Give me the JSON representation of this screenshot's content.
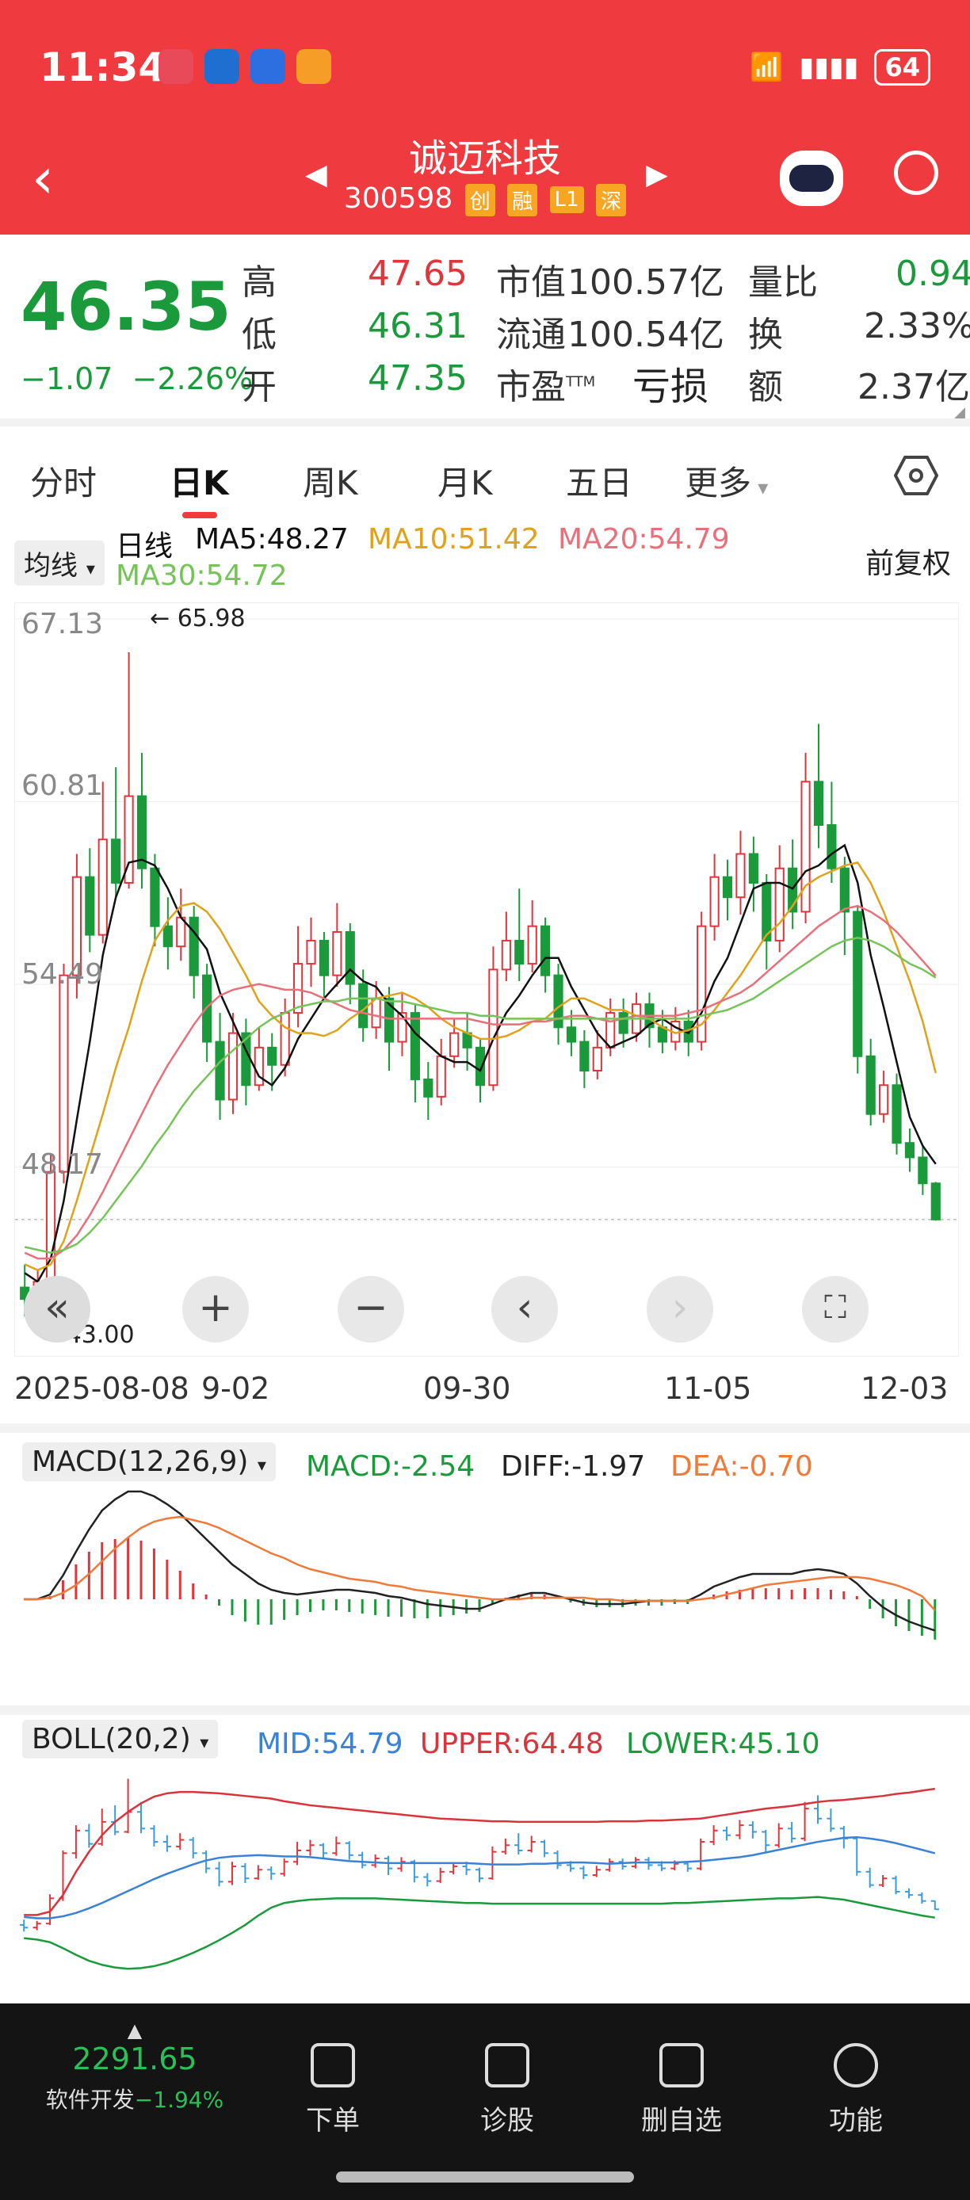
{
  "status_bar": {
    "time": "11:34",
    "battery": "64"
  },
  "header": {
    "stock_name": "诚迈科技",
    "stock_code": "300598",
    "tags": [
      "创",
      "融",
      "L1",
      "深"
    ]
  },
  "quote": {
    "price": "46.35",
    "change": "−1.07",
    "change_pct": "−2.26%",
    "high_label": "高",
    "high": "47.65",
    "low_label": "低",
    "low": "46.31",
    "open_label": "开",
    "open": "47.35",
    "mcap_label": "市值",
    "mcap": "100.57亿",
    "float_label": "流通",
    "float": "100.54亿",
    "pe_label": "市盈",
    "pe_sup": "TTM",
    "pe": "亏损",
    "vol_ratio_label": "量比",
    "vol_ratio": "0.94",
    "turnover_label": "换",
    "turnover": "2.33%",
    "amount_label": "额",
    "amount": "2.37亿"
  },
  "tabs": [
    "分时",
    "日K",
    "周K",
    "月K",
    "五日",
    "更多"
  ],
  "ma_legend": {
    "selector": "均线",
    "period": "日线",
    "ma5": "MA5:48.27",
    "ma10": "MA10:51.42",
    "ma20": "MA20:54.79",
    "ma30": "MA30:54.72",
    "adjust": "前复权"
  },
  "price_axis": [
    "67.13",
    "60.81",
    "54.49",
    "48.17"
  ],
  "annotations": {
    "high_mark": "65.98",
    "low_mark": "43.00"
  },
  "dates": [
    "2025-08-08",
    "9-02",
    "09-30",
    "11-05",
    "12-03"
  ],
  "macd": {
    "selector": "MACD(12,26,9)",
    "macd": "MACD:-2.54",
    "diff": "DIFF:-1.97",
    "dea": "DEA:-0.70"
  },
  "boll": {
    "selector": "BOLL(20,2)",
    "mid": "MID:54.79",
    "upper": "UPPER:64.48",
    "lower": "LOWER:45.10"
  },
  "bottom_bar": {
    "index_value": "2291.65",
    "index_name": "软件开发",
    "index_change": "−1.94%",
    "items": [
      "下单",
      "诊股",
      "删自选",
      "功能"
    ]
  },
  "colors": {
    "up": "#e2343b",
    "down": "#1a9a3b",
    "ma5": "#111111",
    "ma10": "#e0a21a",
    "ma20": "#e8707a",
    "ma30": "#76c35a"
  },
  "chart_data": {
    "type": "candlestick",
    "ylim": [
      43.0,
      67.13
    ],
    "candles": [
      [
        44.0,
        43.6,
        44.8,
        43.0
      ],
      [
        43.6,
        44.2,
        44.6,
        43.2
      ],
      [
        44.2,
        48.0,
        48.6,
        44.0
      ],
      [
        48.0,
        54.8,
        55.2,
        47.6
      ],
      [
        54.8,
        58.2,
        59.0,
        54.0
      ],
      [
        58.2,
        56.2,
        59.2,
        55.6
      ],
      [
        56.2,
        59.5,
        61.5,
        55.9
      ],
      [
        59.5,
        58.0,
        62.0,
        57.5
      ],
      [
        58.0,
        61.0,
        65.98,
        57.8
      ],
      [
        61.0,
        58.5,
        62.5,
        57.8
      ],
      [
        58.5,
        56.5,
        59.0,
        55.8
      ],
      [
        56.5,
        55.8,
        57.5,
        55.0
      ],
      [
        55.8,
        56.8,
        57.8,
        55.3
      ],
      [
        56.8,
        54.8,
        57.2,
        54.0
      ],
      [
        54.8,
        52.5,
        55.2,
        51.8
      ],
      [
        52.5,
        50.5,
        53.5,
        49.8
      ],
      [
        50.5,
        52.8,
        53.5,
        50.0
      ],
      [
        52.8,
        51.0,
        53.3,
        50.3
      ],
      [
        51.0,
        52.3,
        53.0,
        50.8
      ],
      [
        52.3,
        51.7,
        52.8,
        50.8
      ],
      [
        51.7,
        53.5,
        54.0,
        51.3
      ],
      [
        53.5,
        55.2,
        56.5,
        53.0
      ],
      [
        55.2,
        56.0,
        56.8,
        54.4
      ],
      [
        56.0,
        54.8,
        56.3,
        54.0
      ],
      [
        54.8,
        56.3,
        57.3,
        54.4
      ],
      [
        56.3,
        54.5,
        56.6,
        53.8
      ],
      [
        54.5,
        53.0,
        55.0,
        52.5
      ],
      [
        53.0,
        54.0,
        54.6,
        52.6
      ],
      [
        54.0,
        52.5,
        54.4,
        51.5
      ],
      [
        52.5,
        53.5,
        54.2,
        52.0
      ],
      [
        53.5,
        51.2,
        53.8,
        50.4
      ],
      [
        51.2,
        50.6,
        51.8,
        49.8
      ],
      [
        50.6,
        52.0,
        52.6,
        50.3
      ],
      [
        52.0,
        52.8,
        53.3,
        51.6
      ],
      [
        52.8,
        52.3,
        53.5,
        51.5
      ],
      [
        52.3,
        51.0,
        52.6,
        50.4
      ],
      [
        51.0,
        55.0,
        55.8,
        50.8
      ],
      [
        55.0,
        56.0,
        57.0,
        54.6
      ],
      [
        56.0,
        55.2,
        57.8,
        54.6
      ],
      [
        55.2,
        56.5,
        57.4,
        54.9
      ],
      [
        56.5,
        54.8,
        56.8,
        54.2
      ],
      [
        54.8,
        53.0,
        55.2,
        52.4
      ],
      [
        53.0,
        52.5,
        53.6,
        52.0
      ],
      [
        52.5,
        51.5,
        52.9,
        50.9
      ],
      [
        51.5,
        52.3,
        52.9,
        51.2
      ],
      [
        52.3,
        53.5,
        54.0,
        52.0
      ],
      [
        53.5,
        52.8,
        54.0,
        52.3
      ],
      [
        52.8,
        53.8,
        54.2,
        52.5
      ],
      [
        53.8,
        53.0,
        54.2,
        52.3
      ],
      [
        53.0,
        52.5,
        53.6,
        52.1
      ],
      [
        52.5,
        53.2,
        53.7,
        52.2
      ],
      [
        53.2,
        52.5,
        53.6,
        52.0
      ],
      [
        52.5,
        56.5,
        57.0,
        52.2
      ],
      [
        56.5,
        58.2,
        59.0,
        56.0
      ],
      [
        58.2,
        57.5,
        58.8,
        56.7
      ],
      [
        57.5,
        59.0,
        59.8,
        56.9
      ],
      [
        59.0,
        58.0,
        59.6,
        57.0
      ],
      [
        58.0,
        56.0,
        58.3,
        55.0
      ],
      [
        56.0,
        58.5,
        59.3,
        55.6
      ],
      [
        58.5,
        57.0,
        59.5,
        56.4
      ],
      [
        57.0,
        61.5,
        62.5,
        56.6
      ],
      [
        61.5,
        60.0,
        63.5,
        59.2
      ],
      [
        60.0,
        58.5,
        61.5,
        58.0
      ],
      [
        58.5,
        57.0,
        58.9,
        55.5
      ],
      [
        57.0,
        52.0,
        57.2,
        51.4
      ],
      [
        52.0,
        50.0,
        52.6,
        49.6
      ],
      [
        50.0,
        51.0,
        51.5,
        49.7
      ],
      [
        51.0,
        49.0,
        51.4,
        48.6
      ],
      [
        49.0,
        48.5,
        49.5,
        48.0
      ],
      [
        48.5,
        47.6,
        48.9,
        47.2
      ],
      [
        47.6,
        46.35,
        47.65,
        46.31
      ]
    ],
    "ma5": [
      44.5,
      44.2,
      45.0,
      47.0,
      49.8,
      52.5,
      55.5,
      57.5,
      58.7,
      58.8,
      58.6,
      57.8,
      56.8,
      56.3,
      55.7,
      54.2,
      53.2,
      52.2,
      51.3,
      51.0,
      51.6,
      52.6,
      53.3,
      54.0,
      54.5,
      55.0,
      54.6,
      54.4,
      53.8,
      53.4,
      52.8,
      52.4,
      52.0,
      51.8,
      51.8,
      51.5,
      52.6,
      53.5,
      54.1,
      54.8,
      55.4,
      55.4,
      54.4,
      53.6,
      52.8,
      52.3,
      52.5,
      52.7,
      53.1,
      53.3,
      53.0,
      52.8,
      53.5,
      54.6,
      55.4,
      56.6,
      57.8,
      58.0,
      58.0,
      57.8,
      58.4,
      58.6,
      59.0,
      59.3,
      58.0,
      55.5,
      53.7,
      51.8,
      49.9,
      48.9,
      48.27
    ],
    "ma10": [
      44.8,
      44.6,
      44.8,
      45.6,
      47.0,
      48.5,
      50.0,
      51.6,
      53.0,
      54.6,
      56.0,
      56.7,
      57.2,
      57.3,
      57.0,
      56.4,
      55.6,
      54.8,
      53.9,
      53.4,
      53.0,
      52.8,
      52.8,
      52.7,
      52.9,
      53.3,
      53.6,
      54.0,
      54.1,
      54.2,
      54.0,
      53.7,
      53.3,
      53.0,
      52.8,
      52.6,
      52.6,
      52.7,
      52.9,
      53.2,
      53.3,
      53.7,
      54.0,
      54.0,
      53.8,
      53.6,
      53.6,
      53.4,
      53.3,
      53.0,
      52.8,
      52.9,
      53.1,
      53.6,
      54.2,
      54.8,
      55.5,
      56.2,
      56.6,
      57.2,
      57.9,
      58.2,
      58.4,
      58.6,
      58.7,
      58.0,
      57.0,
      55.8,
      54.6,
      53.2,
      51.42
    ],
    "ma20": [
      45.2,
      45.0,
      45.0,
      45.3,
      45.8,
      46.5,
      47.3,
      48.2,
      49.1,
      50.0,
      50.9,
      51.7,
      52.4,
      53.1,
      53.7,
      54.1,
      54.3,
      54.4,
      54.5,
      54.4,
      54.3,
      54.3,
      54.2,
      54.0,
      53.8,
      53.6,
      53.5,
      53.4,
      53.3,
      53.3,
      53.3,
      53.3,
      53.3,
      53.3,
      53.3,
      53.2,
      53.1,
      53.1,
      53.1,
      53.2,
      53.2,
      53.3,
      53.4,
      53.4,
      53.3,
      53.2,
      53.3,
      53.4,
      53.4,
      53.4,
      53.4,
      53.5,
      53.6,
      53.8,
      54.0,
      54.2,
      54.5,
      54.9,
      55.3,
      55.7,
      56.1,
      56.5,
      56.8,
      57.1,
      57.2,
      57.0,
      56.7,
      56.3,
      55.8,
      55.3,
      54.79
    ],
    "ma30": [
      45.4,
      45.3,
      45.2,
      45.3,
      45.5,
      45.9,
      46.4,
      47.0,
      47.6,
      48.2,
      48.9,
      49.5,
      50.2,
      50.8,
      51.3,
      51.8,
      52.2,
      52.6,
      53.0,
      53.3,
      53.5,
      53.7,
      53.8,
      53.9,
      53.9,
      54.0,
      54.0,
      54.0,
      53.9,
      53.9,
      53.8,
      53.7,
      53.6,
      53.5,
      53.5,
      53.4,
      53.4,
      53.3,
      53.3,
      53.3,
      53.3,
      53.3,
      53.3,
      53.3,
      53.3,
      53.3,
      53.3,
      53.3,
      53.3,
      53.3,
      53.3,
      53.3,
      53.4,
      53.5,
      53.6,
      53.8,
      54.0,
      54.3,
      54.6,
      54.9,
      55.2,
      55.5,
      55.8,
      56.0,
      56.1,
      56.0,
      55.8,
      55.5,
      55.2,
      55.0,
      54.72
    ],
    "macd_hist": [
      0,
      0,
      0.2,
      1.2,
      2.2,
      3.0,
      3.6,
      3.8,
      3.9,
      3.7,
      3.2,
      2.5,
      1.8,
      1.0,
      0.3,
      -0.4,
      -1.0,
      -1.4,
      -1.6,
      -1.6,
      -1.3,
      -1.0,
      -0.8,
      -0.7,
      -0.7,
      -0.8,
      -0.9,
      -1.0,
      -1.1,
      -1.1,
      -1.2,
      -1.2,
      -1.1,
      -1.0,
      -0.9,
      -0.8,
      -0.3,
      0.1,
      0.3,
      0.4,
      0.3,
      0.0,
      -0.2,
      -0.4,
      -0.5,
      -0.5,
      -0.5,
      -0.4,
      -0.4,
      -0.4,
      -0.3,
      -0.3,
      0.0,
      0.3,
      0.5,
      0.6,
      0.7,
      0.7,
      0.7,
      0.6,
      0.7,
      0.7,
      0.6,
      0.5,
      0.2,
      -0.6,
      -1.2,
      -1.7,
      -2.0,
      -2.3,
      -2.54
    ],
    "diff": [
      0,
      0,
      0.3,
      1.5,
      3.0,
      4.4,
      5.6,
      6.3,
      6.8,
      6.8,
      6.5,
      6.0,
      5.4,
      4.6,
      3.8,
      3.0,
      2.2,
      1.6,
      1.0,
      0.6,
      0.4,
      0.3,
      0.4,
      0.5,
      0.6,
      0.6,
      0.5,
      0.4,
      0.2,
      0.1,
      -0.1,
      -0.3,
      -0.4,
      -0.5,
      -0.6,
      -0.6,
      -0.3,
      0.0,
      0.2,
      0.4,
      0.4,
      0.2,
      0.0,
      -0.2,
      -0.3,
      -0.3,
      -0.3,
      -0.2,
      -0.1,
      -0.1,
      -0.1,
      -0.1,
      0.3,
      0.8,
      1.1,
      1.4,
      1.6,
      1.6,
      1.6,
      1.6,
      1.8,
      1.9,
      1.8,
      1.6,
      1.0,
      0.2,
      -0.5,
      -1.0,
      -1.4,
      -1.7,
      -1.97
    ],
    "dea": [
      0,
      0,
      0.1,
      0.4,
      0.9,
      1.6,
      2.4,
      3.2,
      3.9,
      4.5,
      4.9,
      5.1,
      5.2,
      5.0,
      4.8,
      4.5,
      4.1,
      3.7,
      3.3,
      2.9,
      2.6,
      2.2,
      1.9,
      1.7,
      1.5,
      1.3,
      1.2,
      1.1,
      0.9,
      0.8,
      0.6,
      0.5,
      0.4,
      0.3,
      0.2,
      0.1,
      0.0,
      0.0,
      0.0,
      0.1,
      0.1,
      0.1,
      0.1,
      0.1,
      0.0,
      0.0,
      -0.1,
      -0.1,
      -0.1,
      -0.1,
      -0.1,
      -0.1,
      0.0,
      0.1,
      0.3,
      0.5,
      0.7,
      0.9,
      1.0,
      1.1,
      1.2,
      1.3,
      1.4,
      1.4,
      1.4,
      1.3,
      1.1,
      0.9,
      0.6,
      0.2,
      -0.7
    ],
    "boll_upper": [
      45.5,
      45.5,
      46.0,
      48.5,
      52.0,
      55.0,
      57.5,
      59.5,
      61.0,
      62.3,
      63.3,
      63.8,
      64.0,
      64.0,
      63.9,
      63.8,
      63.6,
      63.4,
      63.2,
      63.0,
      62.6,
      62.3,
      62.0,
      61.8,
      61.6,
      61.4,
      61.2,
      61.0,
      60.8,
      60.6,
      60.4,
      60.2,
      60.0,
      59.9,
      59.8,
      59.7,
      59.6,
      59.6,
      59.5,
      59.5,
      59.5,
      59.5,
      59.5,
      59.5,
      59.5,
      59.6,
      59.6,
      59.6,
      59.7,
      59.7,
      59.8,
      59.9,
      60.0,
      60.3,
      60.6,
      60.9,
      61.2,
      61.5,
      61.7,
      61.9,
      62.2,
      62.5,
      62.7,
      62.8,
      63.0,
      63.2,
      63.4,
      63.7,
      63.9,
      64.2,
      64.48
    ],
    "boll_lower": [
      42.0,
      41.8,
      41.4,
      40.5,
      39.5,
      38.6,
      38.0,
      37.6,
      37.4,
      37.5,
      37.8,
      38.3,
      39.0,
      39.8,
      40.7,
      41.7,
      42.8,
      44.0,
      45.4,
      46.6,
      47.3,
      47.6,
      47.8,
      47.9,
      48.0,
      48.0,
      48.0,
      48.0,
      47.9,
      47.8,
      47.7,
      47.6,
      47.5,
      47.4,
      47.3,
      47.3,
      47.2,
      47.2,
      47.2,
      47.2,
      47.2,
      47.2,
      47.2,
      47.2,
      47.2,
      47.2,
      47.2,
      47.2,
      47.2,
      47.2,
      47.3,
      47.3,
      47.4,
      47.5,
      47.6,
      47.7,
      47.8,
      47.9,
      48.0,
      48.0,
      48.1,
      48.2,
      48.0,
      47.8,
      47.4,
      47.0,
      46.6,
      46.2,
      45.8,
      45.4,
      45.1
    ]
  }
}
